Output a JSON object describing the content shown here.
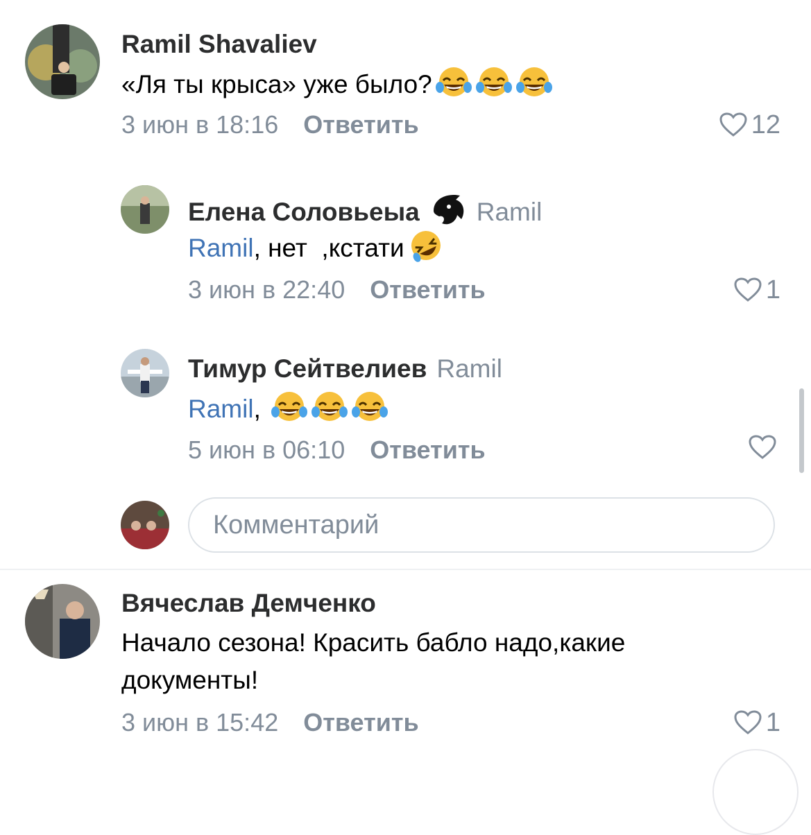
{
  "comments": [
    {
      "author": "Ramil Shavaliev",
      "reply_to": "",
      "mention": "",
      "text": "«Ля ты крыса» уже было?",
      "emoji": [
        "😂",
        "😂",
        "😂"
      ],
      "date": "3 июн в 18:16",
      "reply_label": "Ответить",
      "likes": "12"
    },
    {
      "author": "Елена Соловьеыа",
      "reply_to": "Ramil",
      "mention": "Ramil",
      "text": ", нет  ,кстати",
      "emoji": [
        "🤣"
      ],
      "date": "3 июн в 22:40",
      "reply_label": "Ответить",
      "likes": "1"
    },
    {
      "author": "Тимур Сейтвелиев",
      "reply_to": "Ramil",
      "mention": "Ramil",
      "text": ", ",
      "emoji": [
        "😂",
        "😂",
        "😂"
      ],
      "date": "5 июн в 06:10",
      "reply_label": "Ответить",
      "likes": ""
    },
    {
      "author": "Вячеслав Демченко",
      "reply_to": "",
      "mention": "",
      "text_line1": "Начало сезона! Красить бабло надо,какие",
      "text_line2": "документы!",
      "date": "3 июн в 15:42",
      "reply_label": "Ответить",
      "likes": "1"
    }
  ],
  "comment_input": {
    "placeholder": "Комментарий"
  },
  "colors": {
    "author": "#2c2d2e",
    "secondary": "#818c99",
    "link": "#3f73b5",
    "emoji_yellow": "#f7c03b"
  }
}
